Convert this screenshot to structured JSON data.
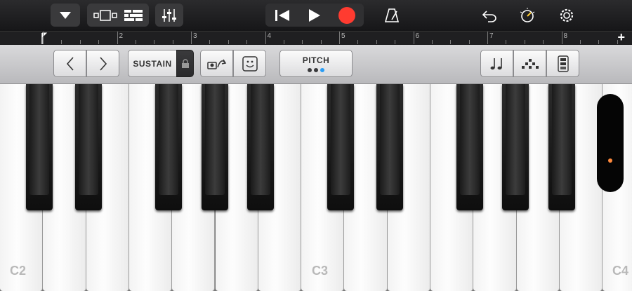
{
  "toolbar": {
    "icons": [
      "tracks-dropdown-icon",
      "view-toggle-icon",
      "tracks-list-icon",
      "mixer-icon",
      "rewind-icon",
      "play-icon",
      "record-icon",
      "metronome-icon",
      "undo-icon",
      "master-effects-icon",
      "settings-icon"
    ],
    "record_color": "#ff3b30"
  },
  "ruler": {
    "bars": [
      "2",
      "3",
      "4",
      "5",
      "6",
      "7",
      "8"
    ],
    "add_label": "+"
  },
  "controls": {
    "sustain_label": "SUSTAIN",
    "pitch_label": "PITCH",
    "pitch_dot_colors": [
      "#3a3a3c",
      "#3a3a3c",
      "#2a9df4"
    ]
  },
  "keyboard": {
    "octave_labels": [
      "C2",
      "C3",
      "C4"
    ],
    "mod_wheel_dot_color": "#ff8a3d"
  }
}
